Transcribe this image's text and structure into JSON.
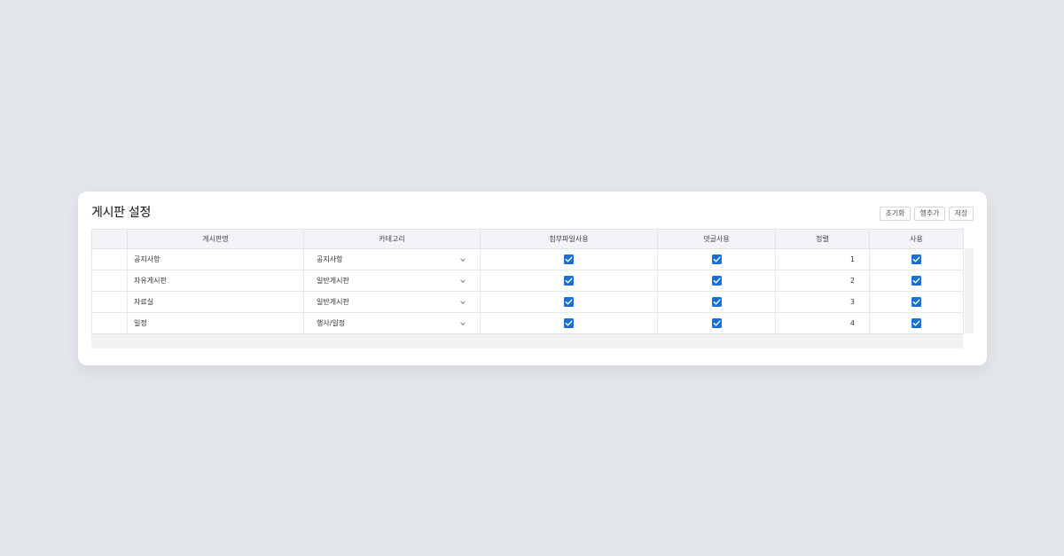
{
  "title": "게시판 설정",
  "toolbar": {
    "reset_label": "초기화",
    "add_row_label": "행추가",
    "save_label": "저장"
  },
  "columns": [
    "",
    "게시판명",
    "카테고리",
    "첨부파일사용",
    "댓글사용",
    "정렬",
    "사용"
  ],
  "rows": [
    {
      "name": "공지사항",
      "category": "공지사항",
      "attachment": true,
      "comment": true,
      "order": "1",
      "use": true
    },
    {
      "name": "자유게시판",
      "category": "일반게시판",
      "attachment": true,
      "comment": true,
      "order": "2",
      "use": true
    },
    {
      "name": "자료실",
      "category": "일반게시판",
      "attachment": true,
      "comment": true,
      "order": "3",
      "use": true
    },
    {
      "name": "일정",
      "category": "행사/일정",
      "attachment": true,
      "comment": true,
      "order": "4",
      "use": true
    }
  ],
  "colors": {
    "accent": "#1a6fd6",
    "background": "#e3e6eb",
    "header_bg": "#f3f4f7"
  },
  "icons": {
    "dropdown": "chevron-down-icon",
    "checkbox": "checkbox-checked-icon"
  }
}
